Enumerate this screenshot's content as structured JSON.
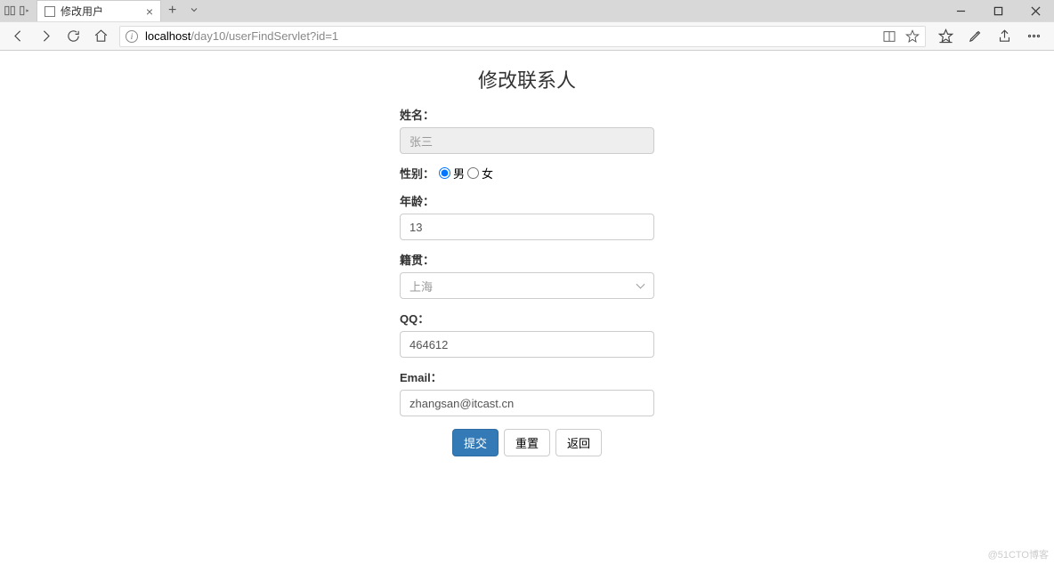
{
  "browser": {
    "tab_title": "修改用户",
    "tab_add": "+",
    "url_host": "localhost",
    "url_path": "/day10/userFindServlet?id=1",
    "window": {
      "minimize": "—",
      "maximize": "□",
      "close": "×"
    }
  },
  "page": {
    "title": "修改联系人",
    "form": {
      "name_label": "姓名：",
      "name_value": "张三",
      "gender_label": "性别：",
      "gender_male": "男",
      "gender_female": "女",
      "gender_selected": "male",
      "age_label": "年龄：",
      "age_value": "13",
      "origin_label": "籍贯：",
      "origin_value": "上海",
      "qq_label": "QQ：",
      "qq_value": "464612",
      "email_label": "Email：",
      "email_value": "zhangsan@itcast.cn",
      "submit": "提交",
      "reset": "重置",
      "back": "返回"
    },
    "watermark": "@51CTO博客"
  }
}
